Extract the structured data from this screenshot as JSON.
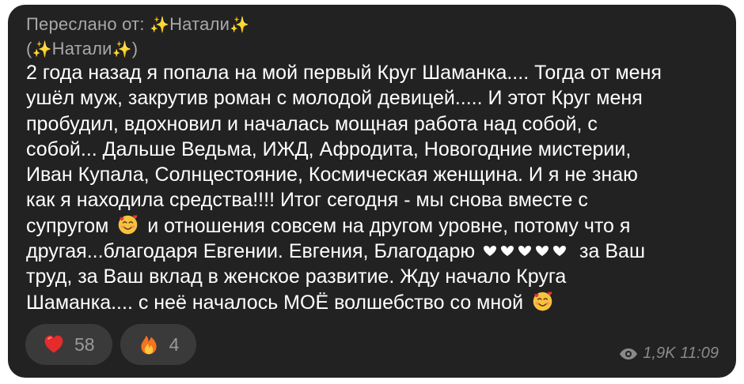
{
  "forward": {
    "prefix": "Переслано от:",
    "name": "Натали",
    "paren_open": "(",
    "paren_name": "Натали",
    "paren_close": ")",
    "sparkle_icon": "sparkles-icon"
  },
  "message": {
    "lines": [
      "2 года назад я попала на мой первый Круг Шаманка.... Тогда от меня",
      "ушёл муж, закрутив роман с молодой девицей..... И этот Круг меня",
      "пробудил, вдохновил и началась мощная работа над собой, с",
      "собой... Дальше Ведьма, ИЖД, Афродита, Новогодние мистерии,",
      "Иван Купала, Солнцестояние, Космическая женщина. И я не знаю",
      "как я находила средства!!!! Итог сегодня - мы снова вместе с"
    ],
    "line7_a": "супругом",
    "line7_b": "и отношения совсем на другом уровне, потому что я",
    "line8_a": "другая...благодаря Евгении. Евгения, Благодарю",
    "line8_b": "за Ваш",
    "line9": "труд, за Ваш вклад в женское развитие. Жду начало Круга",
    "line10": "Шаманка.... с неё началось МОЁ волшебство со мной",
    "emoji_icon": "smiling-face-with-hearts-icon",
    "hearts_icon": "black-heart-icon"
  },
  "reactions": [
    {
      "icon": "red-heart-icon",
      "count": "58"
    },
    {
      "icon": "fire-icon",
      "count": "4"
    }
  ],
  "meta": {
    "views": "1,9K",
    "time": "11:09",
    "views_icon": "eye-icon"
  },
  "colors": {
    "bubble_bg": "#222222",
    "text": "#ffffff",
    "muted": "#a8a8a8",
    "reaction_bg": "#3a3a3a"
  }
}
